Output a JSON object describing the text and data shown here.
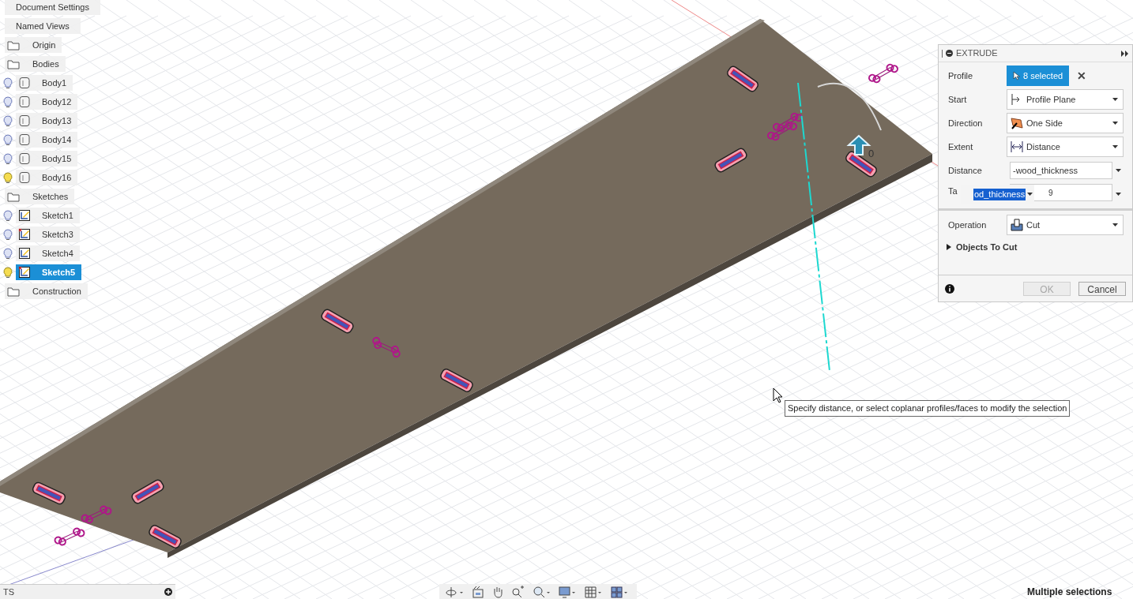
{
  "browser": {
    "items": [
      {
        "label": "Document Settings",
        "kind": "header"
      },
      {
        "label": "Named Views",
        "kind": "header"
      },
      {
        "label": "Origin",
        "kind": "folder"
      },
      {
        "label": "Bodies",
        "kind": "folder",
        "children": [
          {
            "label": "Body1",
            "kind": "body",
            "bulb_lit": false,
            "selected": false
          },
          {
            "label": "Body12",
            "kind": "body",
            "bulb_lit": false,
            "selected": false
          },
          {
            "label": "Body13",
            "kind": "body",
            "bulb_lit": false,
            "selected": false
          },
          {
            "label": "Body14",
            "kind": "body",
            "bulb_lit": false,
            "selected": false
          },
          {
            "label": "Body15",
            "kind": "body",
            "bulb_lit": false,
            "selected": false
          },
          {
            "label": "Body16",
            "kind": "body",
            "bulb_lit": true,
            "selected": false
          }
        ]
      },
      {
        "label": "Sketches",
        "kind": "folder",
        "children": [
          {
            "label": "Sketch1",
            "kind": "sketch",
            "bulb_lit": false,
            "selected": false,
            "marked": false
          },
          {
            "label": "Sketch3",
            "kind": "sketch",
            "bulb_lit": false,
            "selected": false,
            "marked": true
          },
          {
            "label": "Sketch4",
            "kind": "sketch",
            "bulb_lit": false,
            "selected": false,
            "marked": false
          },
          {
            "label": "Sketch5",
            "kind": "sketch",
            "bulb_lit": true,
            "selected": true,
            "marked": true
          }
        ]
      },
      {
        "label": "Construction",
        "kind": "folder"
      }
    ]
  },
  "dialog": {
    "title": "EXTRUDE",
    "rows": [
      {
        "kind": "selection",
        "label": "Profile",
        "value": "8 selected",
        "clear": "✕"
      },
      {
        "kind": "dropdown",
        "label": "Start",
        "value": "Profile Plane"
      },
      {
        "kind": "dropdown",
        "label": "Direction",
        "value": "One Side"
      },
      {
        "kind": "dropdown",
        "label": "Extent",
        "value": "Distance"
      },
      {
        "kind": "field",
        "label": "Distance",
        "value": "-wood_thickness"
      },
      {
        "kind": "autocomplete",
        "label": "Ta",
        "value": "9",
        "suggestion": "od_thickness"
      },
      {
        "kind": "divider"
      },
      {
        "kind": "dropdown",
        "label": "Operation",
        "value": "Cut"
      },
      {
        "kind": "section",
        "label": "Objects To Cut",
        "expanded": false
      }
    ],
    "buttons": [
      {
        "label": "OK",
        "disabled": true
      },
      {
        "label": "Cancel",
        "disabled": false
      }
    ]
  },
  "viewport": {
    "tooltip": "Specify distance, or select coplanar profiles/faces to modify the selection",
    "manipulator_value": "0"
  },
  "bottom_panel": {
    "title": "TS"
  },
  "status": "Multiple selections"
}
